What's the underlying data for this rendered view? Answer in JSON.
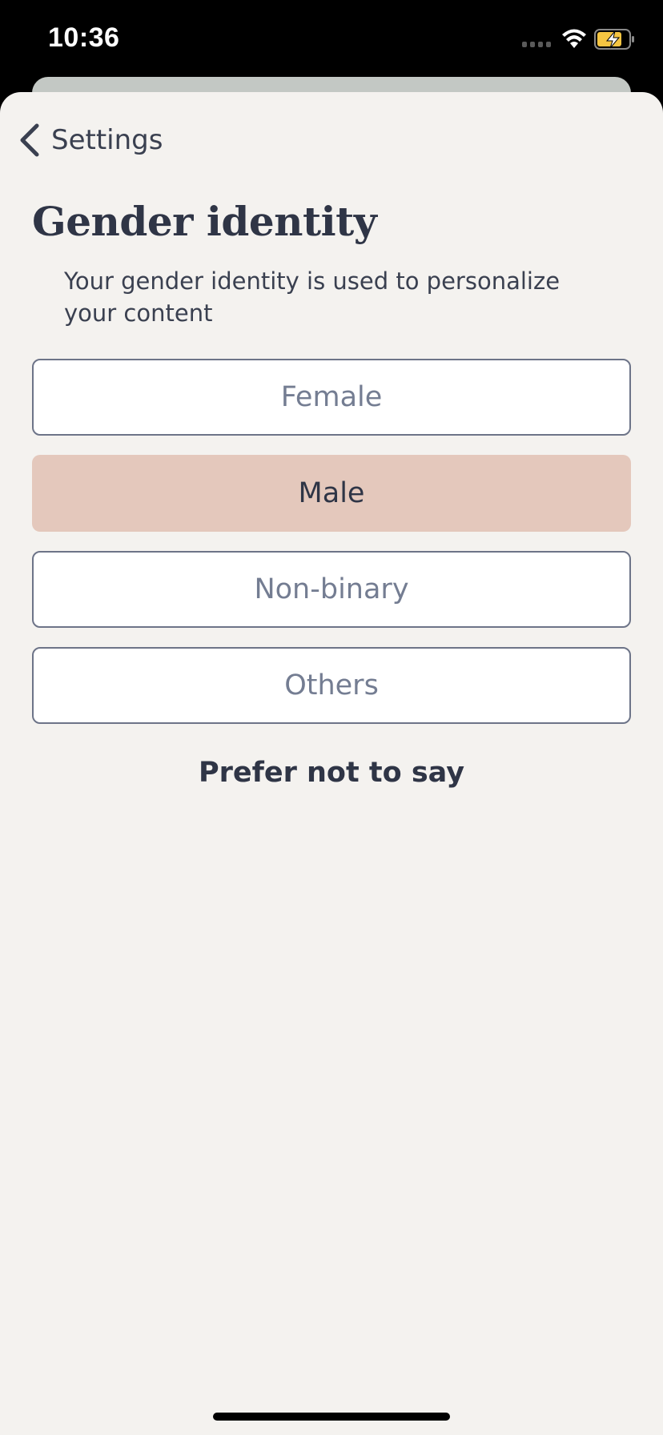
{
  "status_bar": {
    "time": "10:36",
    "icons": [
      "signal-dots-icon",
      "wifi-icon",
      "battery-charging-icon"
    ],
    "battery_color": "#f5c542"
  },
  "nav": {
    "back_label": "Settings",
    "back_icon": "chevron-left-icon"
  },
  "page": {
    "title": "Gender identity",
    "subtitle": "Your gender identity is used to personalize your content"
  },
  "options": [
    {
      "label": "Female",
      "selected": false
    },
    {
      "label": "Male",
      "selected": true
    },
    {
      "label": "Non-binary",
      "selected": false
    },
    {
      "label": "Others",
      "selected": false
    }
  ],
  "prefer_not_label": "Prefer not to say",
  "colors": {
    "sheet_background": "#f4f2ef",
    "selected_option": "#e4c8bc",
    "option_border": "#6d7488",
    "text_primary": "#2f3546",
    "text_muted": "#747d92"
  }
}
